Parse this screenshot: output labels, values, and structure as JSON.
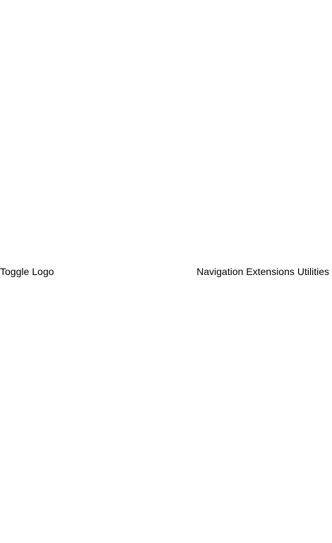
{
  "navbar": {
    "toggle_label": "Toggle",
    "logo_label": "Logo",
    "navigation_label": "Navigation",
    "extensions_label": "Extensions",
    "utilities_label": "Utilities"
  }
}
